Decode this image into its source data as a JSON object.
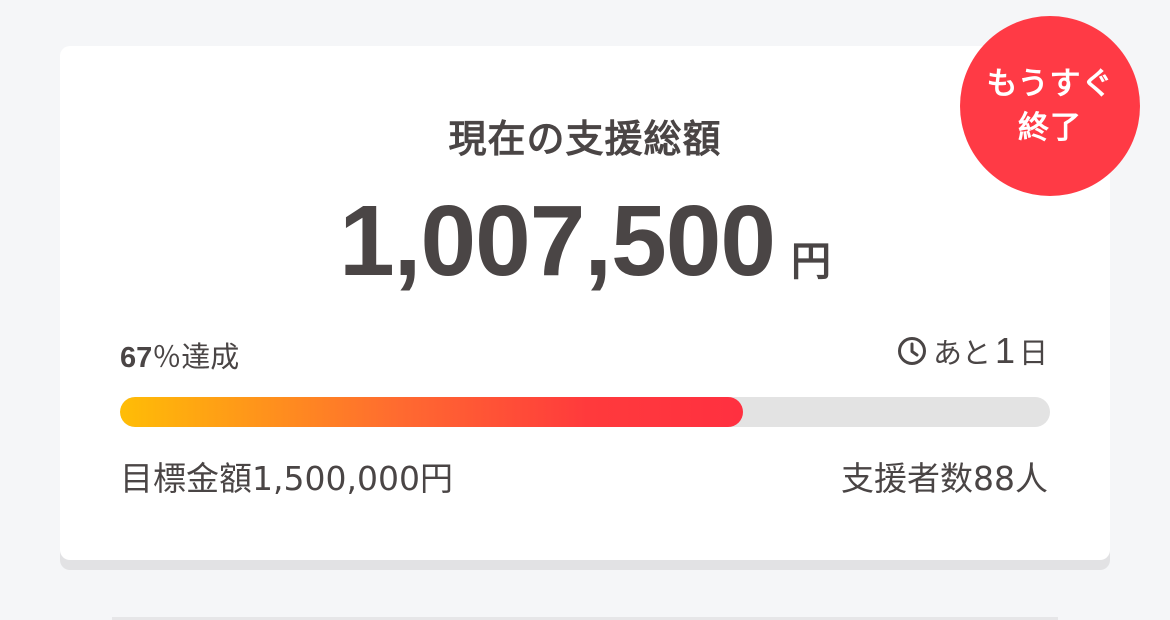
{
  "badge": {
    "line1": "もうすぐ",
    "line2": "終了",
    "color": "#ff3a45"
  },
  "funding": {
    "title": "現在の支援総額",
    "amount": "1,007,500",
    "currency": "円",
    "percent_value": "67",
    "percent_suffix": "％達成",
    "progress_fraction": 0.67,
    "remaining_prefix": "あと",
    "remaining_days": "1",
    "remaining_unit": "日",
    "goal_label": "目標金額1,500,000円",
    "supporters_label": "支援者数88人"
  },
  "icons": {
    "remaining": "clock-icon"
  },
  "colors": {
    "text": "#4a4545",
    "progress_start": "#ffbd06",
    "progress_end": "#ff3040",
    "track": "#e3e3e3"
  }
}
